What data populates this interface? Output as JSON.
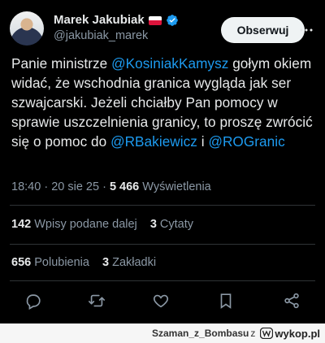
{
  "author": {
    "name": "Marek Jakubiak",
    "handle": "@jakubiak_marek",
    "follow_label": "Obserwuj"
  },
  "tweet": {
    "text_1": "Panie ministrze ",
    "mention_1": "@KosiniakKamysz",
    "text_2": " gołym okiem widać, że wschodnia granica wygląda jak ser szwajcarski. Jeżeli chciałby Pan pomocy w sprawie uszczelnienia granicy, to proszę zwrócić się o pomoc do ",
    "mention_2": "@RBakiewicz",
    "text_3": " i ",
    "mention_3": "@ROGranic"
  },
  "meta": {
    "time": "18:40",
    "sep1": " · ",
    "date": "20 sie 25",
    "sep2": " · ",
    "views": "5 466",
    "views_label": " Wyświetlenia"
  },
  "stats": {
    "retweets": "142",
    "retweets_label": " Wpisy podane dalej",
    "quotes": "3",
    "quotes_label": " Cytaty",
    "likes": "656",
    "likes_label": " Polubienia",
    "bookmarks": "3",
    "bookmarks_label": " Zakładki"
  },
  "footer": {
    "user": "Szaman_z_Bombasu",
    "z": "z",
    "site": "wykop.pl"
  },
  "icons": {
    "reply": "reply-icon",
    "retweet": "retweet-icon",
    "like": "heart-icon",
    "bookmark": "bookmark-icon",
    "share": "share-icon",
    "more": "more-icon",
    "verified": "verified-badge-icon"
  },
  "colors": {
    "background": "#000000",
    "text": "#e7e9ea",
    "secondary": "#8b98a5",
    "link": "#1d9bf0",
    "divider": "#2f3336",
    "button_bg": "#eff3f4",
    "footer_bg": "#f6f6f6"
  }
}
